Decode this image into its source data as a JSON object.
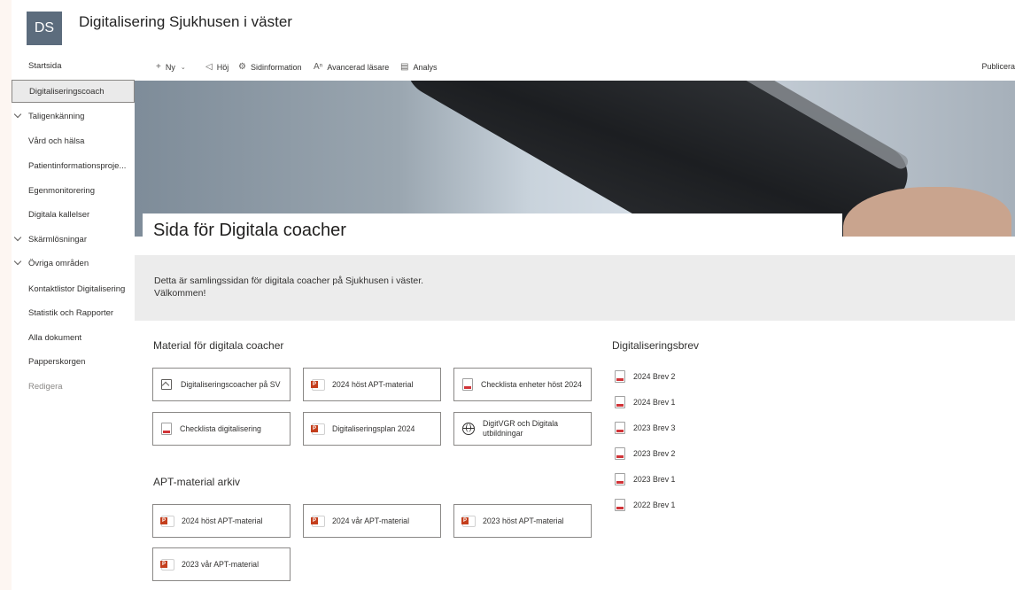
{
  "header": {
    "logo": "DS",
    "site_title": "Digitalisering Sjukhusen i väster"
  },
  "nav": [
    {
      "label": "Startsida"
    },
    {
      "label": "Digitaliseringscoach",
      "active": true
    },
    {
      "label": "Taligenkänning",
      "expandable": true
    },
    {
      "label": "Vård och hälsa"
    },
    {
      "label": "Patientinformationsproje..."
    },
    {
      "label": "Egenmonitorering"
    },
    {
      "label": "Digitala kallelser"
    },
    {
      "label": "Skärmlösningar",
      "expandable": true
    },
    {
      "label": "Övriga områden",
      "expandable": true
    },
    {
      "label": "Kontaktlistor Digitalisering"
    },
    {
      "label": "Statistik och Rapporter"
    },
    {
      "label": "Alla dokument"
    },
    {
      "label": "Papperskorgen"
    },
    {
      "label": "Redigera"
    }
  ],
  "commandbar": {
    "new": "Ny",
    "promote": "Höj",
    "page_details": "Sidinformation",
    "reader": "Avancerad läsare",
    "analytics": "Analys",
    "publish": "Publicera"
  },
  "page_title": "Sida för Digitala coacher",
  "banner": {
    "line1": "Detta är samlingssidan för digitala coacher på Sjukhusen i väster.",
    "line2": "Välkommen!"
  },
  "material": {
    "title": "Material för digitala coacher",
    "tiles": [
      {
        "label": "Digitaliseringscoacher på SV",
        "icon": "image-icon"
      },
      {
        "label": "2024 höst APT-material",
        "icon": "powerpoint-icon"
      },
      {
        "label": "Checklista enheter höst 2024",
        "icon": "pdf-icon"
      },
      {
        "label": "Checklista digitalisering",
        "icon": "pdf-icon"
      },
      {
        "label": "Digitaliseringsplan 2024",
        "icon": "powerpoint-icon"
      },
      {
        "label": "DigitVGR och Digitala utbildningar",
        "icon": "globe-icon"
      }
    ]
  },
  "apt": {
    "title": "APT-material arkiv",
    "tiles": [
      {
        "label": "2024 höst APT-material",
        "icon": "powerpoint-icon"
      },
      {
        "label": "2024 vår APT-material",
        "icon": "powerpoint-icon"
      },
      {
        "label": "2023 höst APT-material",
        "icon": "powerpoint-icon"
      },
      {
        "label": "2023 vår APT-material",
        "icon": "powerpoint-icon"
      }
    ]
  },
  "brev": {
    "title": "Digitaliseringsbrev",
    "items": [
      {
        "label": "2024 Brev 2"
      },
      {
        "label": "2024 Brev 1"
      },
      {
        "label": "2023 Brev 3"
      },
      {
        "label": "2023 Brev 2"
      },
      {
        "label": "2023 Brev 1"
      },
      {
        "label": "2022 Brev 1"
      }
    ]
  }
}
